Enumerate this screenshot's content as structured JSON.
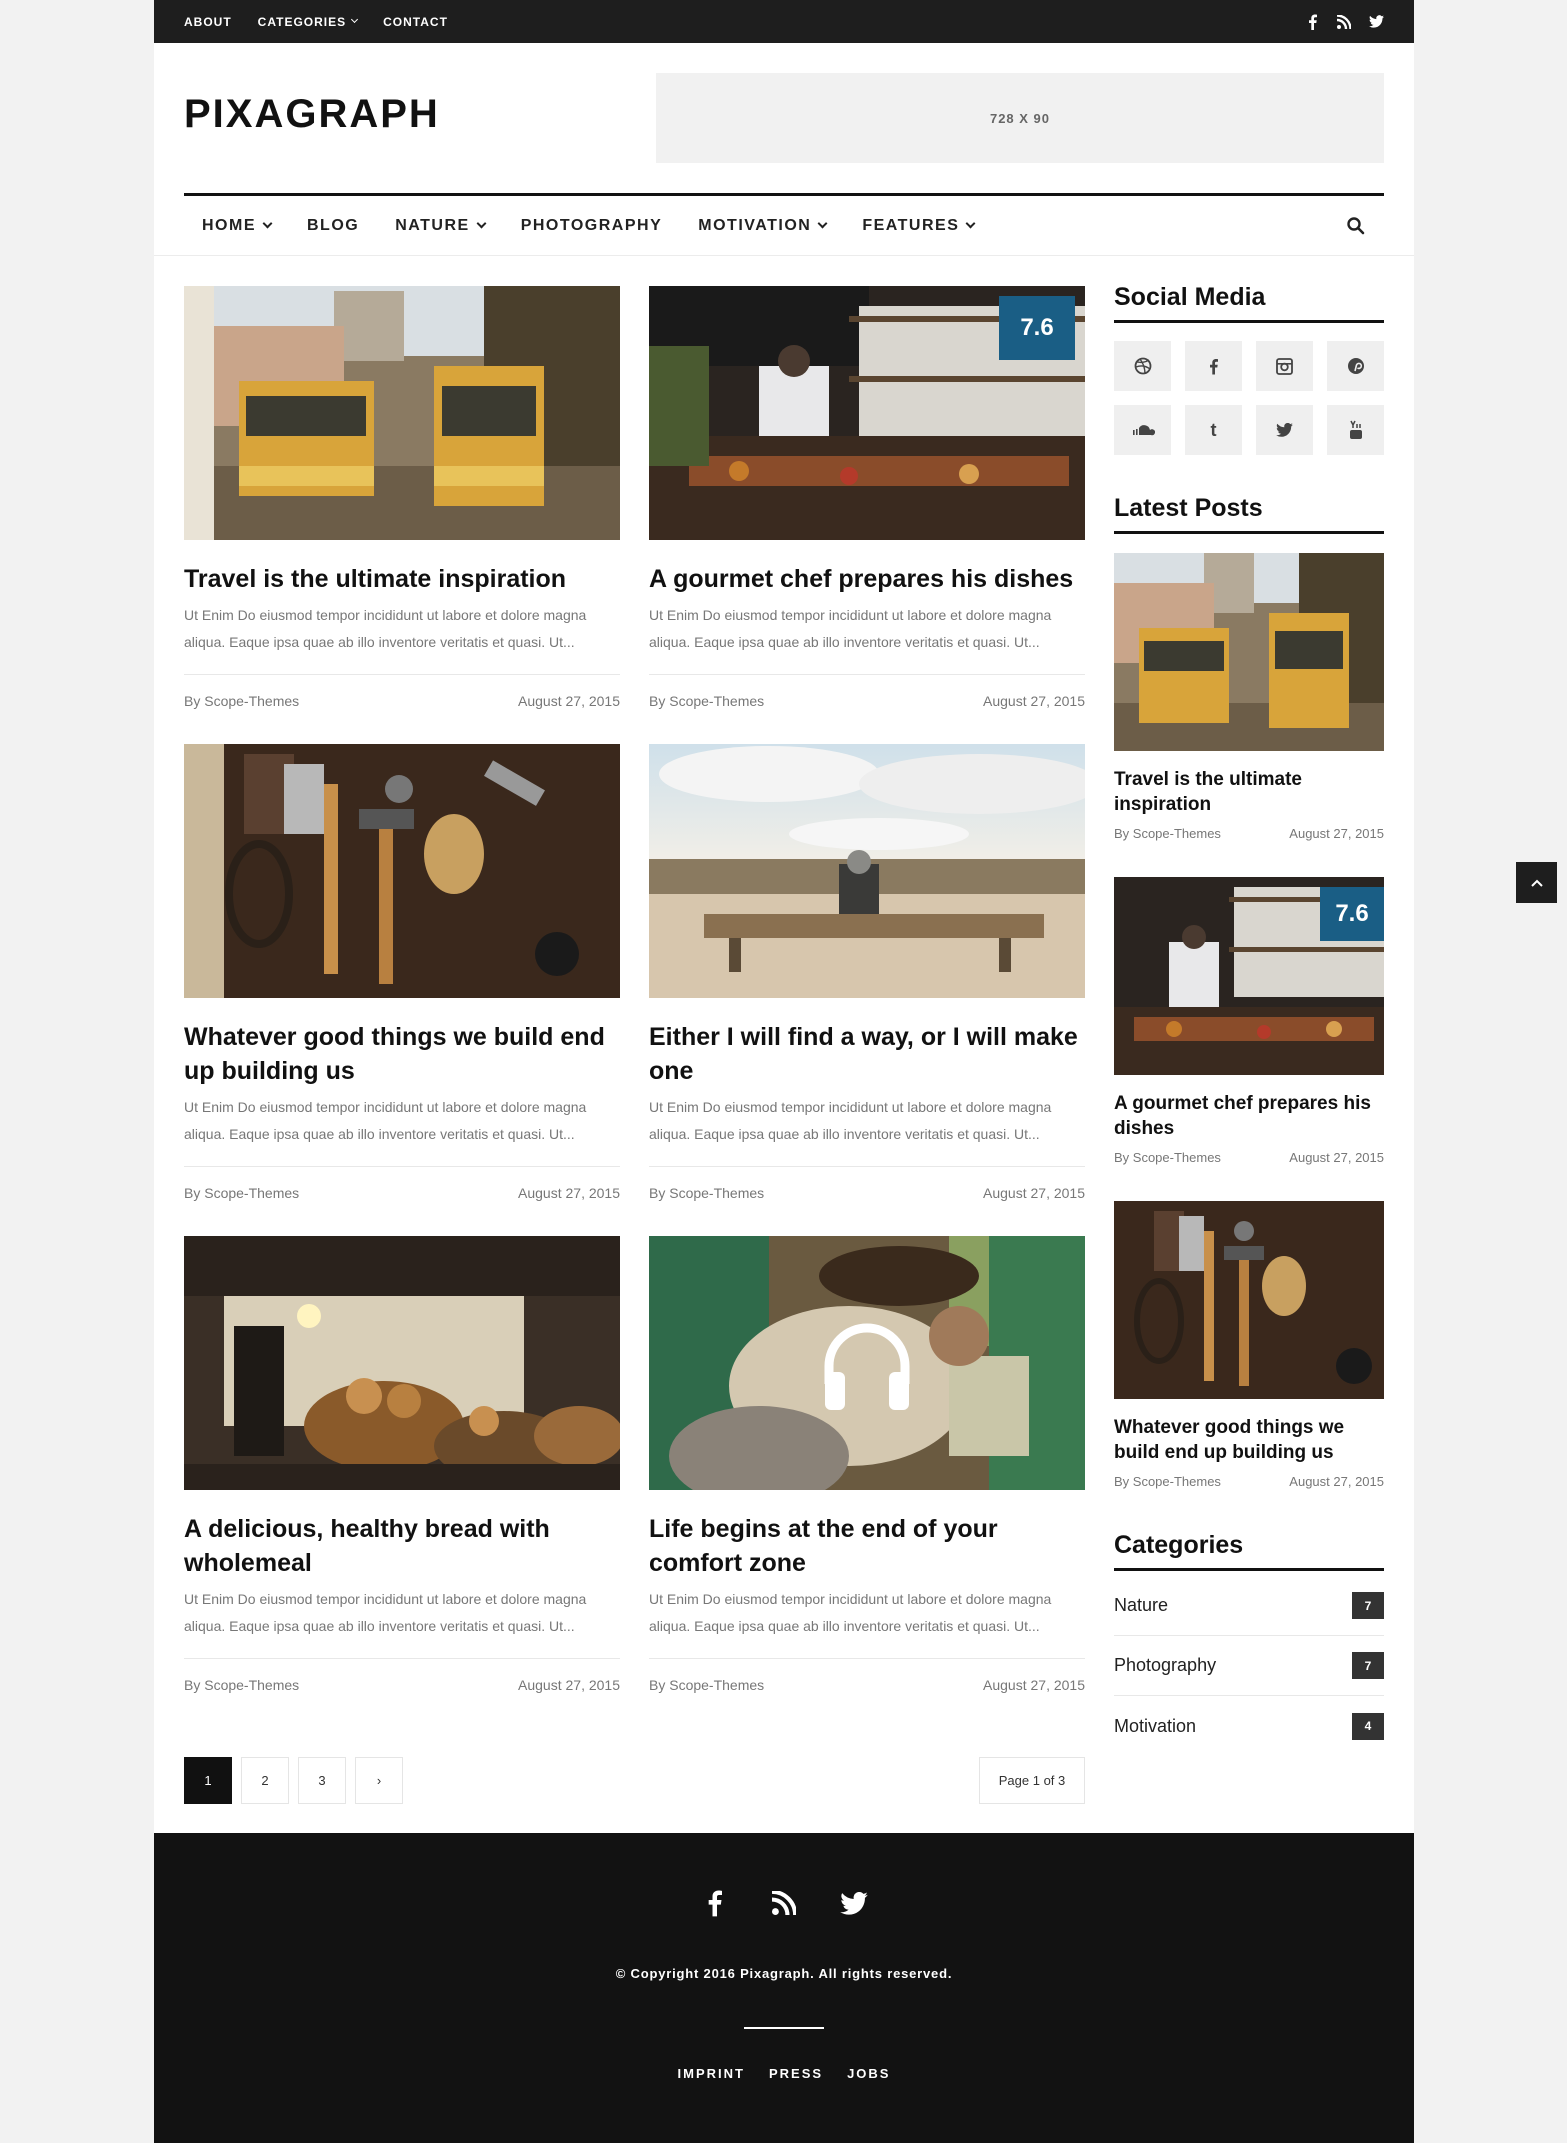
{
  "topbar": {
    "links": [
      "ABOUT",
      "CATEGORIES",
      "CONTACT"
    ],
    "social_icons": [
      "facebook-icon",
      "rss-icon",
      "twitter-icon"
    ]
  },
  "header": {
    "logo": "PIXAGRAPH",
    "ad_text": "728 X 90"
  },
  "mainnav": {
    "items": [
      "HOME",
      "BLOG",
      "NATURE",
      "PHOTOGRAPHY",
      "MOTIVATION",
      "FEATURES"
    ]
  },
  "posts": [
    {
      "title": "Travel is the ultimate inspiration",
      "excerpt": "Ut Enim Do eiusmod tempor incididunt ut labore et dolore magna aliqua. Eaque ipsa quae ab illo inventore veritatis et quasi. Ut...",
      "author": "By Scope-Themes",
      "date": "August 27, 2015",
      "image": "tram-street-photo"
    },
    {
      "title": "A gourmet chef prepares his dishes",
      "excerpt": "Ut Enim Do eiusmod tempor incididunt ut labore et dolore magna aliqua. Eaque ipsa quae ab illo inventore veritatis et quasi. Ut...",
      "author": "By Scope-Themes",
      "date": "August 27, 2015",
      "score": "7.6",
      "image": "chef-kitchen-photo"
    },
    {
      "title": "Whatever good things we build end up building us",
      "excerpt": "Ut Enim Do eiusmod tempor incididunt ut labore et dolore magna aliqua. Eaque ipsa quae ab illo inventore veritatis et quasi. Ut...",
      "author": "By Scope-Themes",
      "date": "August 27, 2015",
      "image": "tools-on-wood-photo"
    },
    {
      "title": "Either I will find a way, or I will make one",
      "excerpt": "Ut Enim Do eiusmod tempor incididunt ut labore et dolore magna aliqua. Eaque ipsa quae ab illo inventore veritatis et quasi. Ut...",
      "author": "By Scope-Themes",
      "date": "August 27, 2015",
      "image": "bench-dunes-photo"
    },
    {
      "title": "A delicious, healthy bread with wholemeal",
      "excerpt": "Ut Enim Do eiusmod tempor incididunt ut labore et dolore magna aliqua. Eaque ipsa quae ab illo inventore veritatis et quasi. Ut...",
      "author": "By Scope-Themes",
      "date": "August 27, 2015",
      "image": "bread-baskets-photo"
    },
    {
      "title": "Life begins at the end of your comfort zone",
      "excerpt": "Ut Enim Do eiusmod tempor incididunt ut labore et dolore magna aliqua. Eaque ipsa quae ab illo inventore veritatis et quasi. Ut...",
      "author": "By Scope-Themes",
      "date": "August 27, 2015",
      "image": "man-in-van-photo",
      "overlay_icon": "headphones-icon"
    }
  ],
  "pagination": {
    "pages": [
      "1",
      "2",
      "3",
      "›"
    ],
    "current": "1",
    "page_of": "Page 1 of 3"
  },
  "sidebar": {
    "social_title": "Social Media",
    "social_icons": [
      "dribbble-icon",
      "facebook-icon",
      "instagram-icon",
      "pinterest-icon",
      "soundcloud-icon",
      "tumblr-icon",
      "twitter-icon",
      "youtube-icon"
    ],
    "latest_title": "Latest Posts",
    "latest": [
      {
        "title": "Travel is the ultimate inspiration",
        "author": "By Scope-Themes",
        "date": "August 27, 2015"
      },
      {
        "title": "A gourmet chef prepares his dishes",
        "author": "By Scope-Themes",
        "date": "August 27, 2015",
        "score": "7.6"
      },
      {
        "title": "Whatever good things we build end up building us",
        "author": "By Scope-Themes",
        "date": "August 27, 2015"
      }
    ],
    "categories_title": "Categories",
    "categories": [
      {
        "name": "Nature",
        "count": "7"
      },
      {
        "name": "Photography",
        "count": "7"
      },
      {
        "name": "Motivation",
        "count": "4"
      }
    ]
  },
  "footer": {
    "icons": [
      "facebook-icon",
      "rss-icon",
      "twitter-icon"
    ],
    "copyright": "© Copyright 2016 Pixagraph. All rights reserved.",
    "links": [
      "IMPRINT",
      "PRESS",
      "JOBS"
    ]
  },
  "colors": {
    "accent": "#1a5e85",
    "dark": "#1e1e1e",
    "footer": "#121212"
  }
}
